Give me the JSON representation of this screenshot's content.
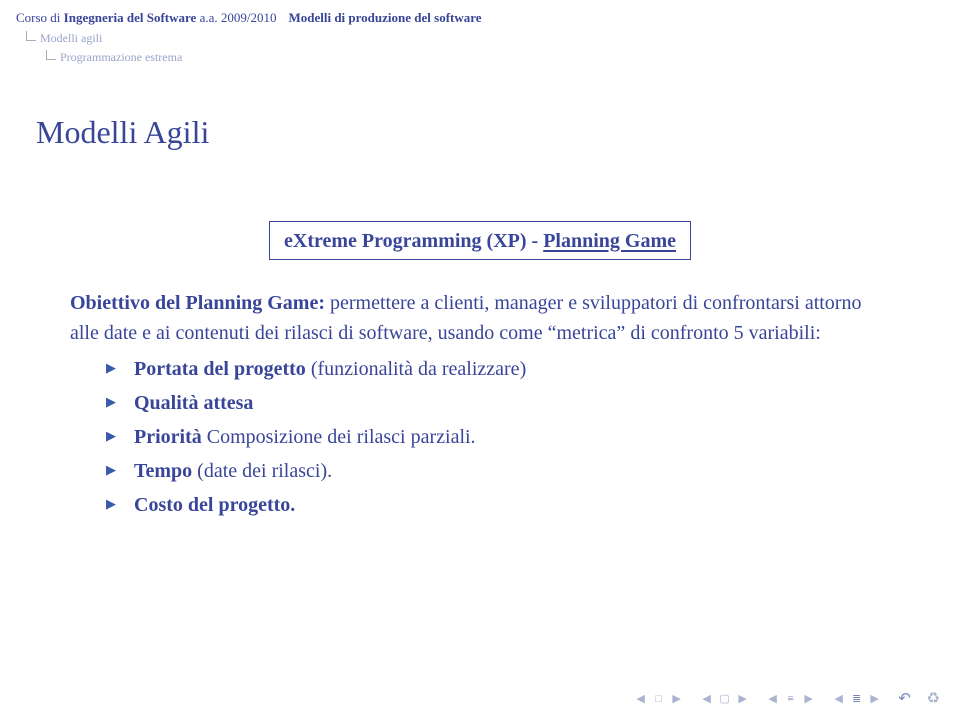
{
  "header": {
    "course_prefix": "Corso di ",
    "course_bold": "Ingegneria del Software",
    "course_year": " a.a. 2009/2010",
    "section": "Modelli di produzione del software",
    "nav1": "Modelli agili",
    "nav2": "Programmazione estrema"
  },
  "title": "Modelli Agili",
  "box": {
    "main": "eXtreme Programming (XP) - ",
    "underlined": "Planning Game"
  },
  "body": {
    "lead_bold": "Obiettivo del Planning Game:",
    "lead_rest": " permettere a clienti, manager e sviluppatori di confrontarsi attorno alle date e ai contenuti dei rilasci di software, usando come \"metrica\" di confronto 5 variabili:"
  },
  "bullets": [
    {
      "bold": "Portata del progetto",
      "rest": " (funzionalità da realizzare)"
    },
    {
      "bold": "Qualità attesa",
      "rest": ""
    },
    {
      "bold": "Priorità",
      "rest": " Composizione dei rilasci parziali."
    },
    {
      "bold": "Tempo",
      "rest": " (date dei rilasci)."
    },
    {
      "bold": "Costo del progetto.",
      "rest": ""
    }
  ]
}
